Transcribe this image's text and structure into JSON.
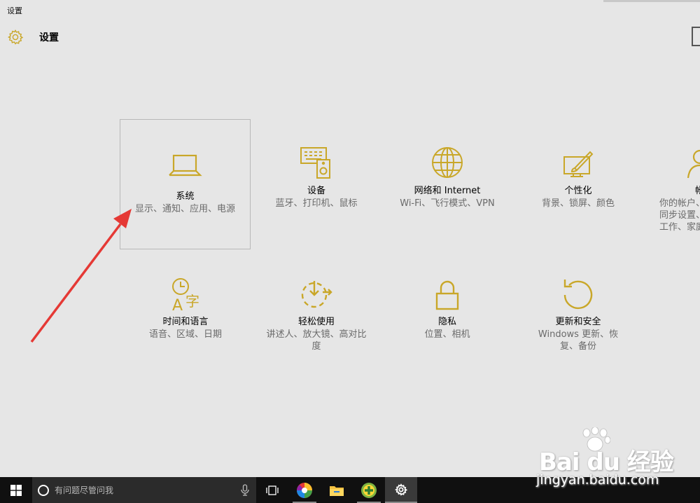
{
  "window": {
    "title": "设置"
  },
  "header": {
    "title": "设置",
    "icon": "gear-icon"
  },
  "accent_color": "#c9a729",
  "tiles_row1": [
    {
      "id": "system",
      "icon": "laptop-icon",
      "name": "系统",
      "desc": "显示、通知、应用、电源",
      "selected": true
    },
    {
      "id": "devices",
      "icon": "devices-icon",
      "name": "设备",
      "desc": "蓝牙、打印机、鼠标"
    },
    {
      "id": "network",
      "icon": "globe-icon",
      "name": "网络和 Internet",
      "desc": "Wi-Fi、飞行模式、VPN"
    },
    {
      "id": "personalization",
      "icon": "personalization-icon",
      "name": "个性化",
      "desc": "背景、锁屏、颜色"
    },
    {
      "id": "accounts",
      "icon": "account-icon",
      "name": "帐户",
      "desc": "你的帐户、同步设置、工作、家庭"
    }
  ],
  "tiles_row2": [
    {
      "id": "time-language",
      "icon": "time-language-icon",
      "name": "时间和语言",
      "desc": "语音、区域、日期"
    },
    {
      "id": "ease-of-access",
      "icon": "ease-of-access-icon",
      "name": "轻松使用",
      "desc": "讲述人、放大镜、高对比度"
    },
    {
      "id": "privacy",
      "icon": "lock-icon",
      "name": "隐私",
      "desc": "位置、相机"
    },
    {
      "id": "update-security",
      "icon": "refresh-icon",
      "name": "更新和安全",
      "desc": "Windows 更新、恢复、备份"
    }
  ],
  "taskbar": {
    "search_placeholder": "有问题尽管问我",
    "icons": [
      "windows-start-icon",
      "cortana-icon",
      "microphone-icon",
      "task-view-icon",
      "browser-icon",
      "file-explorer-icon",
      "app-plus-icon",
      "settings-gear-icon"
    ]
  },
  "watermark": {
    "logo": "Bai du 经验",
    "url": "jingyan.baidu.com"
  }
}
